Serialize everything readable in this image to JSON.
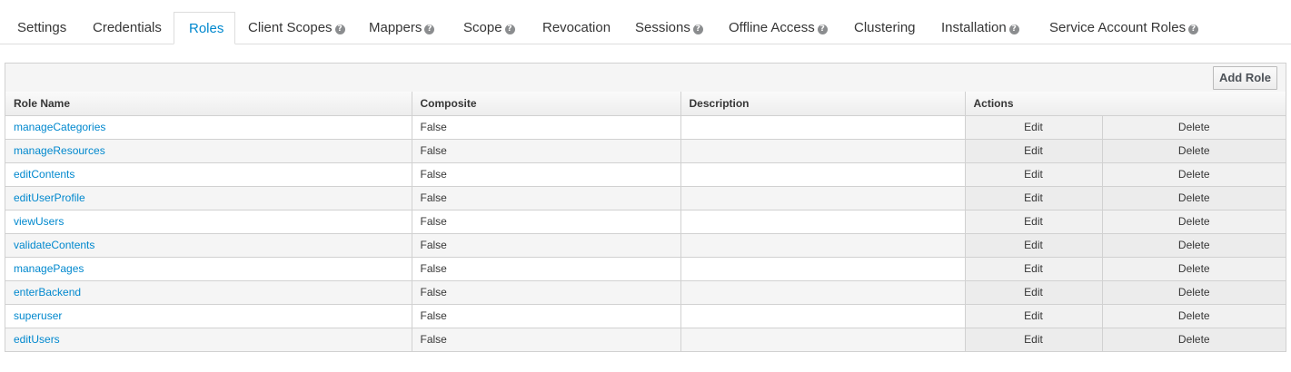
{
  "tabs": [
    {
      "label": "Settings",
      "help": false,
      "active": false
    },
    {
      "label": "Credentials",
      "help": false,
      "active": false
    },
    {
      "label": "Roles",
      "help": false,
      "active": true
    },
    {
      "label": "Client Scopes",
      "help": true,
      "active": false
    },
    {
      "label": "Mappers",
      "help": true,
      "active": false
    },
    {
      "label": "Scope",
      "help": true,
      "active": false
    },
    {
      "label": "Revocation",
      "help": false,
      "active": false
    },
    {
      "label": "Sessions",
      "help": true,
      "active": false
    },
    {
      "label": "Offline Access",
      "help": true,
      "active": false
    },
    {
      "label": "Clustering",
      "help": false,
      "active": false
    },
    {
      "label": "Installation",
      "help": true,
      "active": false
    },
    {
      "label": "Service Account Roles",
      "help": true,
      "active": false
    }
  ],
  "toolbar": {
    "add_role_label": "Add Role"
  },
  "table": {
    "headers": {
      "role_name": "Role Name",
      "composite": "Composite",
      "description": "Description",
      "actions": "Actions"
    },
    "rows": [
      {
        "name": "manageCategories",
        "composite": "False",
        "description": "",
        "edit": "Edit",
        "delete": "Delete"
      },
      {
        "name": "manageResources",
        "composite": "False",
        "description": "",
        "edit": "Edit",
        "delete": "Delete"
      },
      {
        "name": "editContents",
        "composite": "False",
        "description": "",
        "edit": "Edit",
        "delete": "Delete"
      },
      {
        "name": "editUserProfile",
        "composite": "False",
        "description": "",
        "edit": "Edit",
        "delete": "Delete"
      },
      {
        "name": "viewUsers",
        "composite": "False",
        "description": "",
        "edit": "Edit",
        "delete": "Delete"
      },
      {
        "name": "validateContents",
        "composite": "False",
        "description": "",
        "edit": "Edit",
        "delete": "Delete"
      },
      {
        "name": "managePages",
        "composite": "False",
        "description": "",
        "edit": "Edit",
        "delete": "Delete"
      },
      {
        "name": "enterBackend",
        "composite": "False",
        "description": "",
        "edit": "Edit",
        "delete": "Delete"
      },
      {
        "name": "superuser",
        "composite": "False",
        "description": "",
        "edit": "Edit",
        "delete": "Delete"
      },
      {
        "name": "editUsers",
        "composite": "False",
        "description": "",
        "edit": "Edit",
        "delete": "Delete"
      }
    ]
  },
  "colors": {
    "link": "#0088ce",
    "border": "#d1d1d1",
    "header_bg": "#f5f5f5"
  },
  "icons": {
    "help": "question-circle-icon"
  }
}
